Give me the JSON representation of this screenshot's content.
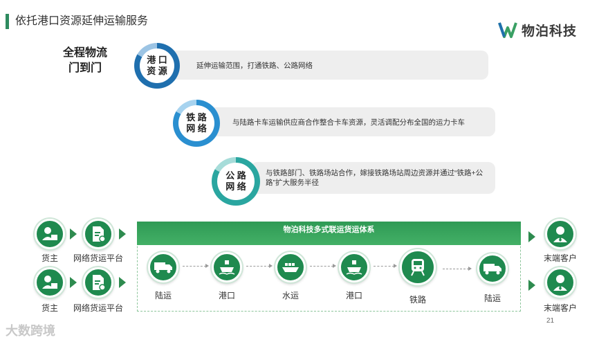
{
  "header": {
    "title": "依托港口资源延伸运输服务"
  },
  "logo": {
    "text": "物泊科技"
  },
  "headline": {
    "line1": "全程物流",
    "line2": "门到门"
  },
  "features": [
    {
      "badge_line1": "港 口",
      "badge_line2": "资 源",
      "text": "延伸运输范围，打通铁路、公路网络",
      "color": "#1f6fae"
    },
    {
      "badge_line1": "铁 路",
      "badge_line2": "网 络",
      "text": "与陆路卡车运输供应商合作整合卡车资源，灵活调配分布全国的运力卡车",
      "color": "#2a8fd0"
    },
    {
      "badge_line1": "公 路",
      "badge_line2": "网 络",
      "text": "与铁路部门、铁路场站合作，嫁接铁路场站周边资源并通过“铁路+公路”扩大服务半径",
      "color": "#2aa6a0"
    }
  ],
  "left_flow": [
    {
      "shipper": "货主",
      "platform": "网络货运平台"
    },
    {
      "shipper": "货主",
      "platform": "网络货运平台"
    }
  ],
  "panel": {
    "title": "物泊科技多式联运货运体系",
    "steps": [
      "陆运",
      "港口",
      "水运",
      "港口",
      "铁路",
      "陆运"
    ]
  },
  "right_flow": [
    {
      "label": "末端客户"
    },
    {
      "label": "末端客户"
    }
  ],
  "footer": {
    "page_number": "21",
    "watermark": "大数跨境"
  },
  "colors": {
    "accent_green": "#1f8a4f",
    "title_bar": "#2e8b5f"
  }
}
